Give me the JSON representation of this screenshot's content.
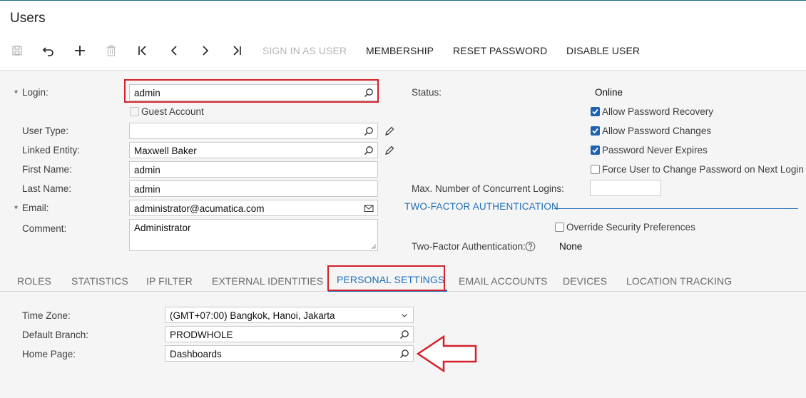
{
  "window": {
    "title": "Users"
  },
  "toolbar": {
    "save_icon": "save-icon",
    "undo_icon": "undo-icon",
    "add_icon": "add-icon",
    "delete_icon": "delete-icon",
    "first_icon": "first-icon",
    "prev_icon": "previous-icon",
    "next_icon": "next-icon",
    "last_icon": "last-icon",
    "sign_in_as_user": "SIGN IN AS USER",
    "membership": "MEMBERSHIP",
    "reset_password": "RESET PASSWORD",
    "disable_user": "DISABLE USER"
  },
  "form": {
    "login": {
      "label": "Login:",
      "value": "admin"
    },
    "guest_account": {
      "label": "Guest Account",
      "checked": false
    },
    "user_type": {
      "label": "User Type:",
      "value": ""
    },
    "linked_entity": {
      "label": "Linked Entity:",
      "value": "Maxwell Baker"
    },
    "first_name": {
      "label": "First Name:",
      "value": "admin"
    },
    "last_name": {
      "label": "Last Name:",
      "value": "admin"
    },
    "email": {
      "label": "Email:",
      "value": "administrator@acumatica.com"
    },
    "comment": {
      "label": "Comment:",
      "value": "Administrator"
    },
    "status": {
      "label": "Status:",
      "value": "Online"
    },
    "allow_password_recovery": {
      "label": "Allow Password Recovery",
      "checked": true
    },
    "allow_password_changes": {
      "label": "Allow Password Changes",
      "checked": true
    },
    "password_never_expires": {
      "label": "Password Never Expires",
      "checked": true
    },
    "force_change_password": {
      "label": "Force User to Change Password on Next Login",
      "checked": false
    },
    "max_concurrent_logins": {
      "label": "Max. Number of Concurrent Logins:",
      "value": ""
    },
    "two_factor_header": "TWO-FACTOR AUTHENTICATION",
    "override_security": {
      "label": "Override Security Preferences",
      "checked": false
    },
    "two_factor_auth": {
      "label": "Two-Factor Authentication:",
      "value": "None"
    }
  },
  "tabs": [
    {
      "label": "ROLES"
    },
    {
      "label": "STATISTICS"
    },
    {
      "label": "IP FILTER"
    },
    {
      "label": "EXTERNAL IDENTITIES"
    },
    {
      "label": "PERSONAL SETTINGS",
      "active": true
    },
    {
      "label": "EMAIL ACCOUNTS"
    },
    {
      "label": "DEVICES"
    },
    {
      "label": "LOCATION TRACKING"
    }
  ],
  "personal_settings": {
    "time_zone": {
      "label": "Time Zone:",
      "value": "(GMT+07:00) Bangkok, Hanoi, Jakarta"
    },
    "default_branch": {
      "label": "Default Branch:",
      "value": "PRODWHOLE"
    },
    "home_page": {
      "label": "Home Page:",
      "value": "Dashboards"
    }
  },
  "colors": {
    "accent": "#1f6fb8",
    "highlight": "#d42129",
    "checkbox": "#1f63b0"
  }
}
